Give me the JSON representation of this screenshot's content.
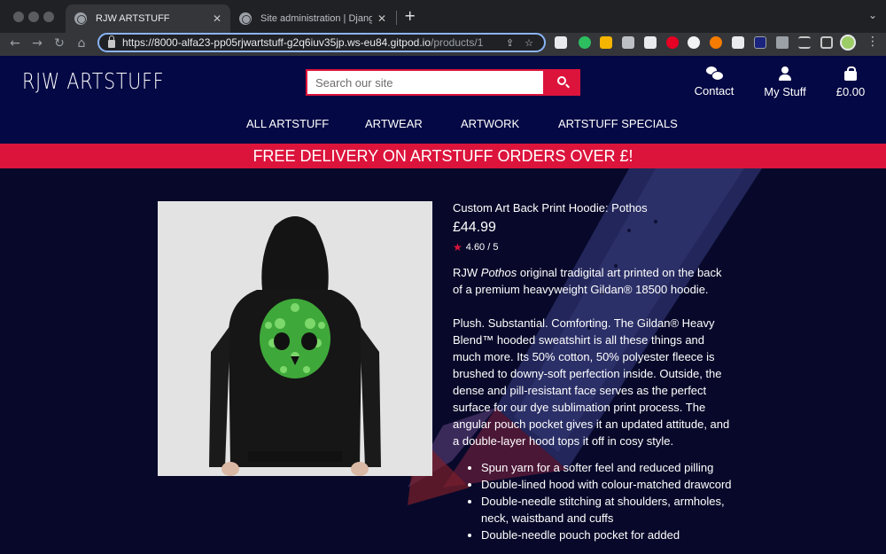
{
  "browser": {
    "tabs": [
      {
        "title": "RJW ARTSTUFF",
        "active": true
      },
      {
        "title": "Site administration | Django site admin",
        "active": false
      }
    ],
    "url_main": "https://8000-alfa23-pp05rjwartstuff-g2q6iuv35jp.ws-eu84.gitpod.io",
    "url_path": "/products/1",
    "extensions": [
      "1password-icon",
      "evernote-icon",
      "notes-icon",
      "extension-icon",
      "extension-icon",
      "pinterest-icon",
      "github-icon",
      "grammarly-icon",
      "clipper-icon",
      "screen-icon",
      "puzzle-icon",
      "reading-list-icon",
      "side-panel-icon"
    ]
  },
  "site": {
    "logo": "RJW ARTSTUFF",
    "search": {
      "placeholder": "Search our site"
    },
    "header_links": {
      "contact": "Contact",
      "account": "My Stuff",
      "bag": "£0.00"
    },
    "nav": [
      "ALL ARTSTUFF",
      "ARTWEAR",
      "ARTWORK",
      "ARTSTUFF SPECIALS"
    ],
    "banner": "FREE DELIVERY ON ARTSTUFF ORDERS OVER £!"
  },
  "product": {
    "title": "Custom Art Back Print Hoodie: Pothos",
    "price": "£44.99",
    "rating": "4.60 / 5",
    "desc1_pre": "RJW ",
    "desc1_em": "Pothos",
    "desc1_post": " original tradigital art printed on the back of a premium heavyweight Gildan® 18500 hoodie.",
    "desc2": "Plush. Substantial. Comforting. The Gildan® Heavy Blend™ hooded sweatshirt is all these things and much more. Its 50% cotton, 50% polyester fleece is brushed to downy-soft perfection inside. Outside, the dense and pill-resistant face serves as the perfect surface for our dye sublimation print process. The angular pouch pocket gives it an updated attitude, and a double-layer hood tops it off in cosy style.",
    "features": [
      "Spun yarn for a softer feel and reduced pilling",
      "Double-lined hood with colour-matched drawcord",
      "Double-needle stitching at shoulders, armholes, neck, waistband and cuffs",
      "Double-needle pouch pocket for added"
    ]
  },
  "colors": {
    "brand_navy": "#040844",
    "accent_crimson": "#dc143c",
    "background": "#08092a"
  }
}
